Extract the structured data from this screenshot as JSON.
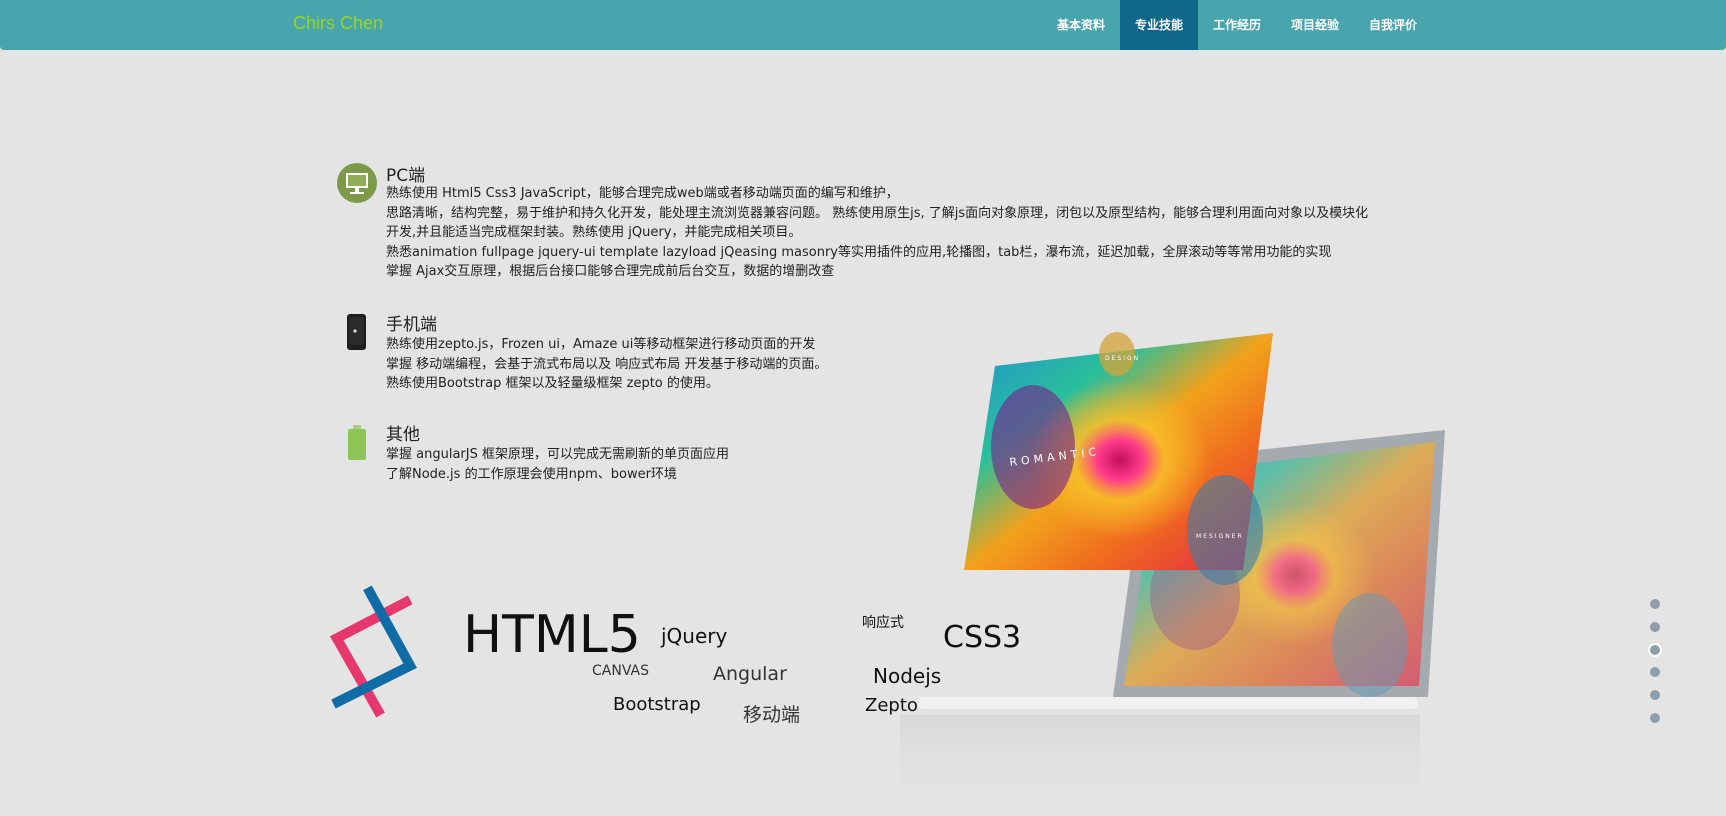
{
  "nav": {
    "brand": "Chirs Chen",
    "items": [
      {
        "label": "基本资料",
        "active": false
      },
      {
        "label": "专业技能",
        "active": true
      },
      {
        "label": "工作经历",
        "active": false
      },
      {
        "label": "项目经验",
        "active": false
      },
      {
        "label": "自我评价",
        "active": false
      }
    ],
    "bg_color": "#48a5ae",
    "active_color": "#10678a",
    "brand_color": "#9ad41a"
  },
  "sections": [
    {
      "icon": "monitor-icon",
      "title": "PC端",
      "lines": [
        "熟练使用 Html5 Css3 JavaScript，能够合理完成web端或者移动端页面的编写和维护，",
        "思路清晰，结构完整，易于维护和持久化开发，能处理主流浏览器兼容问题。 熟练使用原生js, 了解js面向对象原理，闭包以及原型结构，能够合理利用面向对象以及模块化",
        "开发,并且能适当完成框架封装。熟练使用 jQuery，并能完成相关项目。",
        "熟悉animation fullpage jquery-ui template lazyload jQeasing masonry等实用插件的应用,轮播图，tab栏，瀑布流，延迟加载，全屏滚动等等常用功能的实现",
        "掌握 Ajax交互原理，根据后台接口能够合理完成前后台交互，数据的增删改查"
      ]
    },
    {
      "icon": "smartphone-icon",
      "title": "手机端",
      "lines": [
        "熟练使用zepto.js，Frozen ui，Amaze ui等移动框架进行移动页面的开发",
        "掌握 移动端编程，会基于流式布局以及 响应式布局 开发基于移动端的页面。",
        "熟练使用Bootstrap 框架以及轻量级框架 zepto 的使用。"
      ]
    },
    {
      "icon": "battery-icon",
      "title": "其他",
      "lines": [
        "掌握 angularJS 框架原理，可以完成无需刷新的单页面应用",
        "了解Node.js 的工作原理会使用npm、bower环境"
      ]
    }
  ],
  "showcase": {
    "card_texts": [
      "DESIGN",
      "ROMANTIC",
      "MESIGNER"
    ]
  },
  "skills": [
    "HTML5",
    "jQuery",
    "CANVAS",
    "Angular",
    "Bootstrap",
    "移动端",
    "响应式",
    "CSS3",
    "Nodejs",
    "Zepto"
  ],
  "page_dots": {
    "count": 6,
    "active_index": 2
  }
}
